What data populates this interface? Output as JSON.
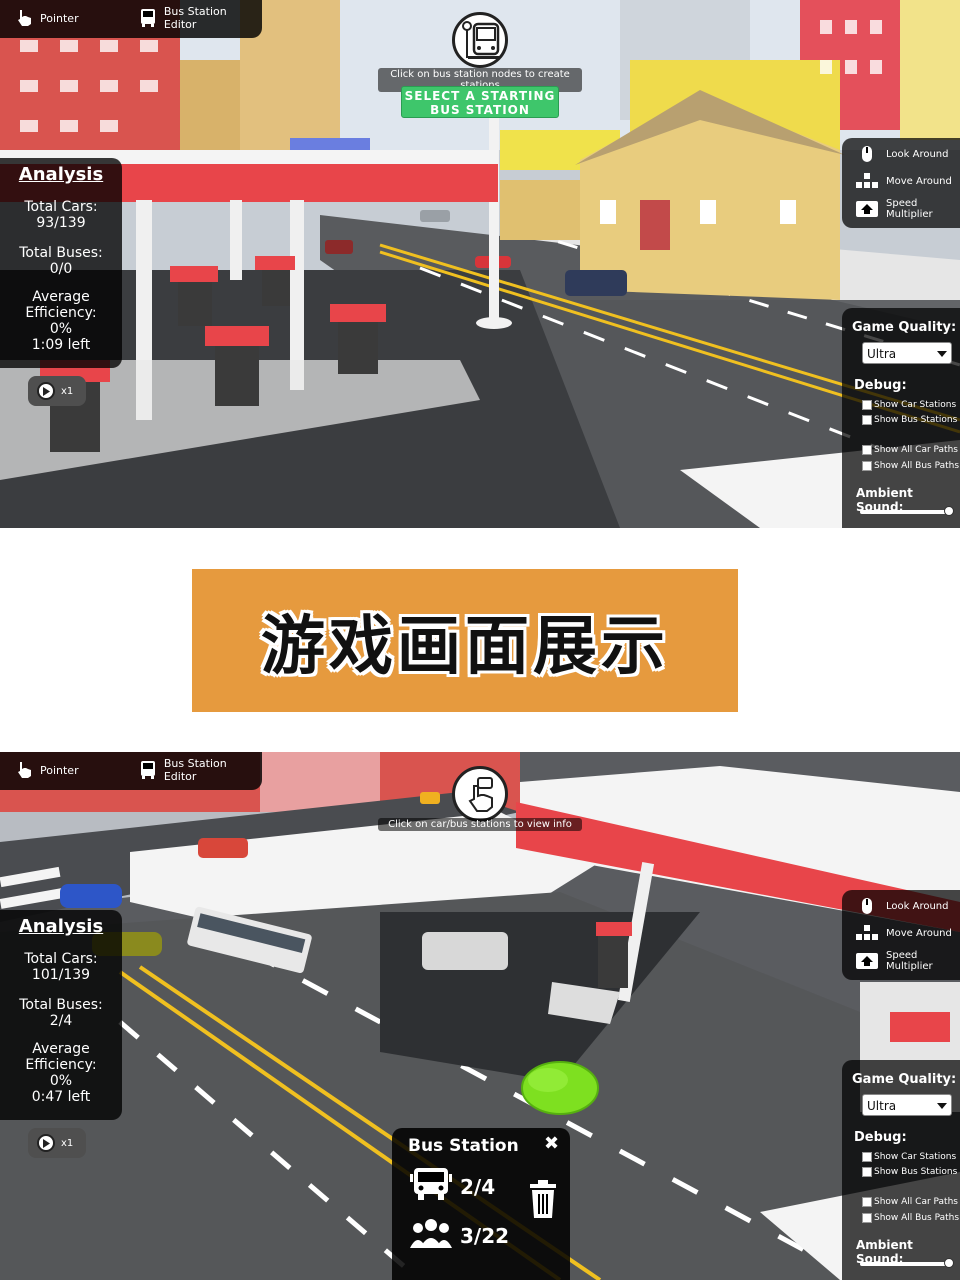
{
  "toolbar": {
    "pointer_label": "Pointer",
    "editor_label": "Bus Station Editor"
  },
  "top_screen": {
    "hint_text": "Click on bus station nodes to create stations",
    "banner_line1": "SELECT A STARTING",
    "banner_line2": "BUS STATION",
    "analysis": {
      "title": "Analysis",
      "total_cars_label": "Total Cars:",
      "total_cars_value": "93/139",
      "total_buses_label": "Total Buses:",
      "total_buses_value": "0/0",
      "efficiency_label_1": "Average",
      "efficiency_label_2": "Efficiency:",
      "efficiency_value": "0%",
      "time_left": "1:09 left"
    },
    "speed_label": "x1"
  },
  "bottom_screen": {
    "hint_text": "Click on car/bus stations to view info",
    "analysis": {
      "title": "Analysis",
      "total_cars_label": "Total Cars:",
      "total_cars_value": "101/139",
      "total_buses_label": "Total Buses:",
      "total_buses_value": "2/4",
      "efficiency_label_1": "Average",
      "efficiency_label_2": "Efficiency:",
      "efficiency_value": "0%",
      "time_left": "0:47 left"
    },
    "speed_label": "x1",
    "bus_station": {
      "title": "Bus Station",
      "close_glyph": "✖",
      "buses": "2/4",
      "passengers": "3/22"
    }
  },
  "controls": {
    "look_around": "Look Around",
    "move_around": "Move Around",
    "speed_multiplier": "Speed Multiplier"
  },
  "settings": {
    "quality_label": "Game Quality:",
    "quality_value": "Ultra",
    "debug_label": "Debug:",
    "show_car_stations": "Show Car Stations",
    "show_bus_stations": "Show Bus Stations",
    "show_all_car_paths": "Show All Car Paths",
    "show_all_bus_paths": "Show All Bus Paths",
    "ambient_label": "Ambient Sound:",
    "ambient_level": 1.0
  },
  "banner_title": "游戏画面展示",
  "colors": {
    "banner_bg": "#e69a3e",
    "select_banner": "#3ec66b",
    "node_green": "#7ee020",
    "gas_red": "#e8454a"
  }
}
